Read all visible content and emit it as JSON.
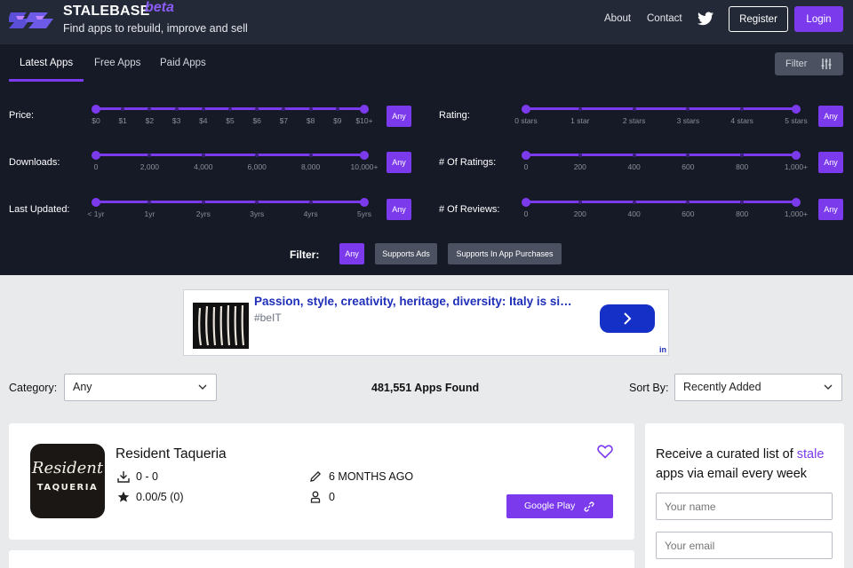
{
  "header": {
    "brand": "STALEBASE",
    "beta": "beta",
    "tagline": "Find apps to rebuild, improve and sell",
    "nav": {
      "about": "About",
      "contact": "Contact"
    },
    "register_label": "Register",
    "login_label": "Login",
    "icons": [
      "stalebase-logo-icon",
      "twitter-icon"
    ]
  },
  "tabs": [
    "Latest Apps",
    "Free Apps",
    "Paid Apps"
  ],
  "filter_button": {
    "label": "Filter",
    "icon": "sliders-icon"
  },
  "sliders": {
    "price": {
      "label": "Price:",
      "ticks": [
        "$0",
        "$1",
        "$2",
        "$3",
        "$4",
        "$5",
        "$6",
        "$7",
        "$8",
        "$9",
        "$10+"
      ],
      "any": "Any"
    },
    "downloads": {
      "label": "Downloads:",
      "ticks": [
        "0",
        "2,000",
        "4,000",
        "6,000",
        "8,000",
        "10,000+"
      ],
      "any": "Any"
    },
    "last_updated": {
      "label": "Last Updated:",
      "ticks": [
        "< 1yr",
        "1yr",
        "2yrs",
        "3yrs",
        "4yrs",
        "5yrs"
      ],
      "any": "Any"
    },
    "rating": {
      "label": "Rating:",
      "ticks": [
        "0 stars",
        "1 star",
        "2 stars",
        "3 stars",
        "4 stars",
        "5 stars"
      ],
      "any": "Any"
    },
    "num_ratings": {
      "label": "# Of Ratings:",
      "ticks": [
        "0",
        "200",
        "400",
        "600",
        "800",
        "1,000+"
      ],
      "any": "Any"
    },
    "num_reviews": {
      "label": "# Of Reviews:",
      "ticks": [
        "0",
        "200",
        "400",
        "600",
        "800",
        "1,000+"
      ],
      "any": "Any"
    }
  },
  "filter_row": {
    "label": "Filter:",
    "chips": [
      "Any",
      "Supports Ads",
      "Supports In App Purchases"
    ]
  },
  "ad": {
    "title": "Passion, style, creativity, heritage, diversity: Italy is si…",
    "subtitle": "#beIT",
    "badge": "in"
  },
  "toolbar": {
    "category_label": "Category:",
    "category_value": "Any",
    "found": "481,551 Apps Found",
    "sort_label": "Sort By:",
    "sort_value": "Recently Added"
  },
  "app": {
    "name": "Resident Taqueria",
    "logo_line1": "Resident",
    "logo_line2": "TAQUERIA",
    "downloads": "0 - 0",
    "rating": "0.00/5 (0)",
    "updated": "6 MONTHS AGO",
    "developers": "0",
    "store_button": "Google Play"
  },
  "newsletter": {
    "text_before": "Receive a curated list of ",
    "highlight": "stale",
    "text_after": " apps via email every week",
    "name_placeholder": "Your name",
    "email_placeholder": "Your email"
  },
  "colors": {
    "accent": "#7c3aed",
    "header_bg": "#242938",
    "filters_bg": "#161a27",
    "page_bg": "#e9eaec"
  }
}
